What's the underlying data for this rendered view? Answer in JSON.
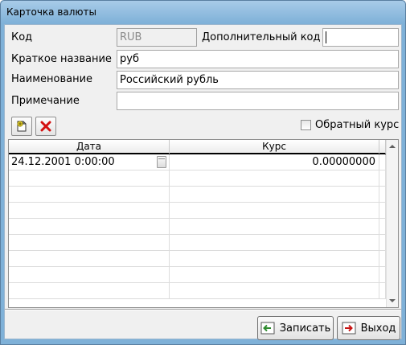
{
  "window": {
    "title": "Карточка валюты"
  },
  "form": {
    "code_label": "Код",
    "code_value": "RUB",
    "extra_code_label": "Дополнительный  код",
    "extra_code_value": "",
    "short_name_label": "Краткое название",
    "short_name_value": "руб",
    "name_label": "Наименование",
    "name_value": "Российский рубль",
    "note_label": "Примечание",
    "note_value": ""
  },
  "toolbar": {
    "add_icon": "new-document-icon",
    "delete_icon": "red-x-icon",
    "reverse_rate_label": "Обратный курс",
    "reverse_rate_checked": false
  },
  "grid": {
    "columns": [
      "Дата",
      "Курс"
    ],
    "rows": [
      {
        "date": "24.12.2001 0:00:00",
        "rate": "0.00000000"
      },
      {
        "date": "",
        "rate": ""
      },
      {
        "date": "",
        "rate": ""
      },
      {
        "date": "",
        "rate": ""
      },
      {
        "date": "",
        "rate": ""
      },
      {
        "date": "",
        "rate": ""
      },
      {
        "date": "",
        "rate": ""
      },
      {
        "date": "",
        "rate": ""
      },
      {
        "date": "",
        "rate": ""
      }
    ]
  },
  "buttons": {
    "save_label": "Записать",
    "exit_label": "Выход"
  },
  "colors": {
    "title_bar": "#7fb1d8",
    "client_bg": "#f0f0f0",
    "delete_red": "#d41010",
    "add_yellow": "#f5e23a"
  }
}
